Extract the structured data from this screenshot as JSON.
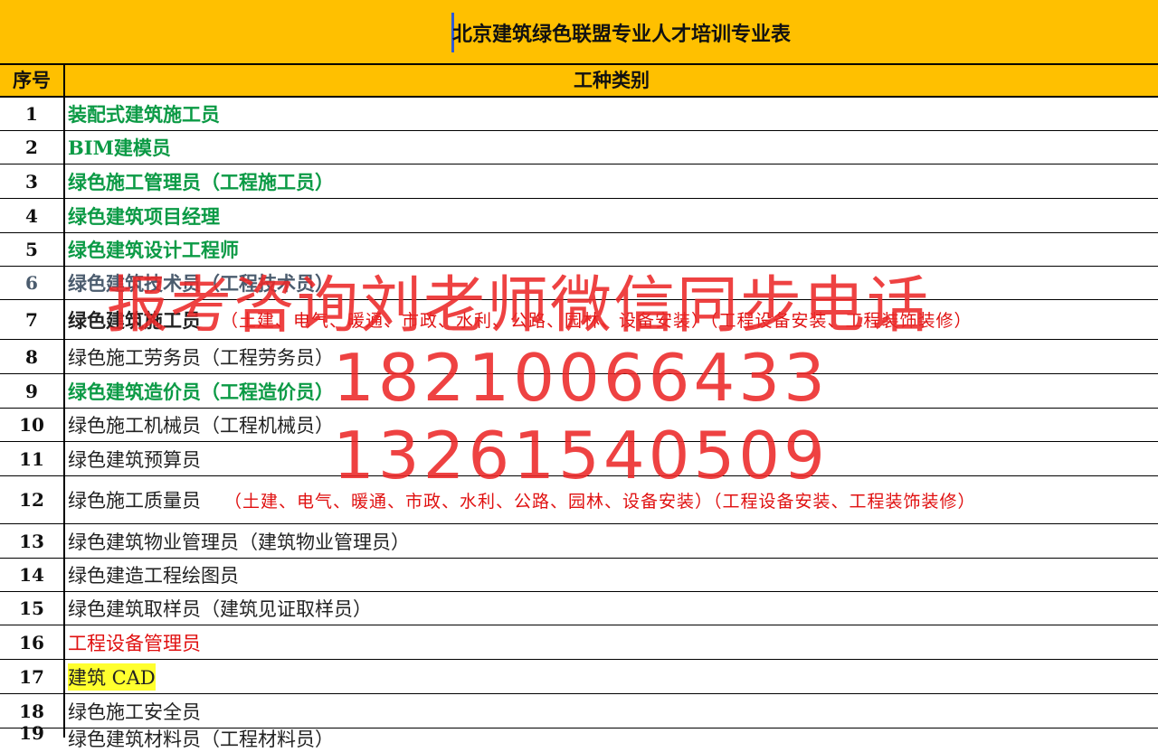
{
  "title": "北京建筑绿色联盟专业人才培训专业表",
  "header": {
    "col_num": "序号",
    "col_type": "工种类别"
  },
  "rows": [
    {
      "num": "1",
      "name": "装配式建筑施工员",
      "note": ""
    },
    {
      "num": "2",
      "name": "BIM建模员",
      "note": ""
    },
    {
      "num": "3",
      "name": "绿色施工管理员（工程施工员）",
      "note": ""
    },
    {
      "num": "4",
      "name": "绿色建筑项目经理",
      "note": ""
    },
    {
      "num": "5",
      "name": "绿色建筑设计工程师",
      "note": ""
    },
    {
      "num": "6",
      "name": "绿色建筑技术员（工程技术员）",
      "note": ""
    },
    {
      "num": "7",
      "name": "绿色建筑施工员",
      "note": "（土建、电气、暖通、市政、水利、公路、园林、设备安装）（工程设备安装、工程装饰装修）"
    },
    {
      "num": "8",
      "name": "绿色施工劳务员（工程劳务员）",
      "note": ""
    },
    {
      "num": "9",
      "name": "绿色建筑造价员（工程造价员）",
      "note": ""
    },
    {
      "num": "10",
      "name": "绿色施工机械员（工程机械员）",
      "note": ""
    },
    {
      "num": "11",
      "name": "绿色建筑预算员",
      "note": ""
    },
    {
      "num": "12",
      "name": "绿色施工质量员",
      "note": "（土建、电气、暖通、市政、水利、公路、园林、设备安装）（工程设备安装、工程装饰装修）"
    },
    {
      "num": "13",
      "name": "绿色建筑物业管理员（建筑物业管理员）",
      "note": ""
    },
    {
      "num": "14",
      "name": "绿色建造工程绘图员",
      "note": ""
    },
    {
      "num": "15",
      "name": "绿色建筑取样员（建筑见证取样员）",
      "note": ""
    },
    {
      "num": "16",
      "name": "工程设备管理员",
      "note": ""
    },
    {
      "num": "17",
      "name": "建筑 CAD",
      "note": ""
    },
    {
      "num": "18",
      "name": "绿色施工安全员",
      "note": ""
    },
    {
      "num": "19",
      "name": "绿色建筑材料员（工程材料员）",
      "note": ""
    }
  ],
  "watermark": {
    "line1": "报考咨询刘老师微信同步电话",
    "line2": "18210066433",
    "line3": "13261540509"
  },
  "colors": {
    "header_bg": "#ffc000",
    "green_text": "#0b9a45",
    "red_text": "#e01010",
    "highlight": "#ffff2e",
    "watermark": "#ec2828"
  }
}
